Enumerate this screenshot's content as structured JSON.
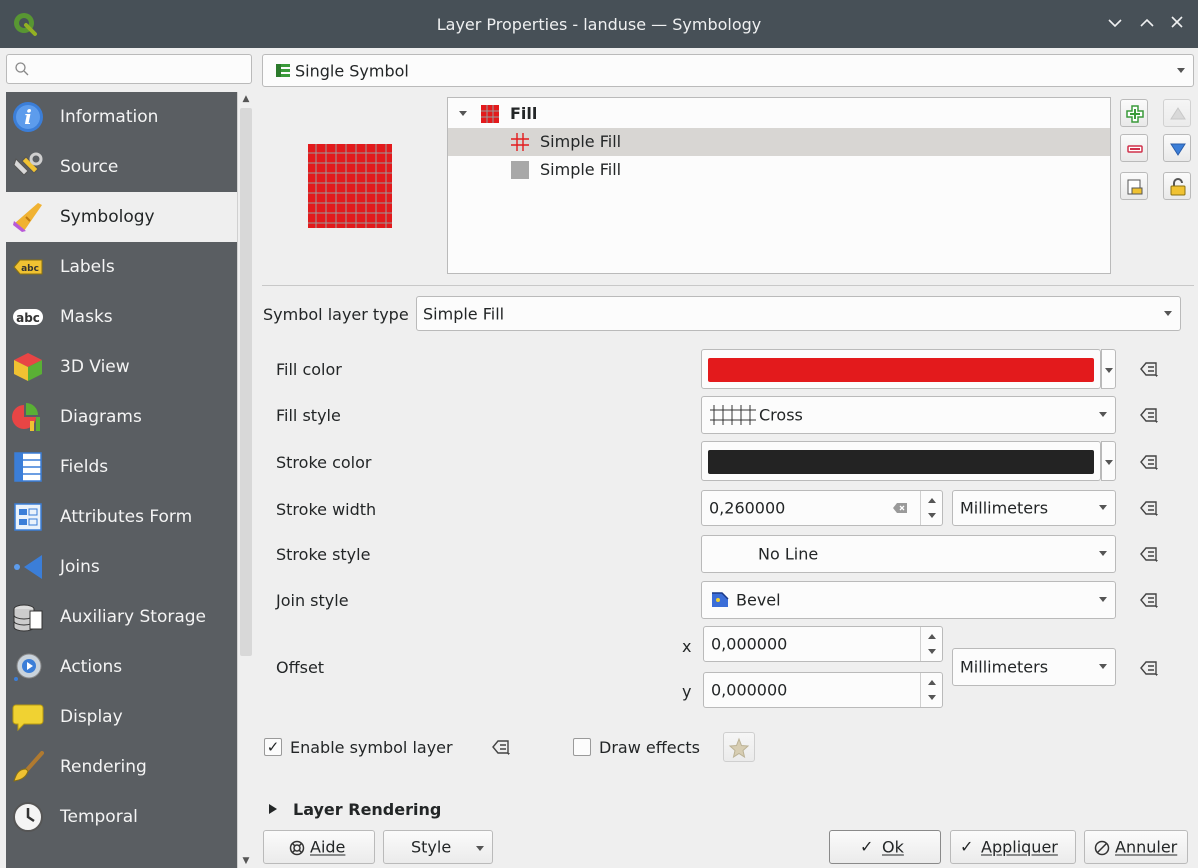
{
  "window": {
    "title": "Layer Properties - landuse — Symbology",
    "controls": [
      "chevron-down-icon",
      "chevron-up-icon",
      "close-icon"
    ]
  },
  "sidebar": {
    "search_placeholder": "",
    "items": [
      {
        "label": "Information",
        "icon": "info-icon"
      },
      {
        "label": "Source",
        "icon": "source-icon"
      },
      {
        "label": "Symbology",
        "icon": "paintbrush-icon",
        "active": true
      },
      {
        "label": "Labels",
        "icon": "labels-icon"
      },
      {
        "label": "Masks",
        "icon": "masks-icon"
      },
      {
        "label": "3D View",
        "icon": "cube-icon"
      },
      {
        "label": "Diagrams",
        "icon": "diagrams-icon"
      },
      {
        "label": "Fields",
        "icon": "fields-icon"
      },
      {
        "label": "Attributes Form",
        "icon": "form-icon"
      },
      {
        "label": "Joins",
        "icon": "joins-icon"
      },
      {
        "label": "Auxiliary Storage",
        "icon": "database-icon"
      },
      {
        "label": "Actions",
        "icon": "actions-icon"
      },
      {
        "label": "Display",
        "icon": "speech-bubble-icon"
      },
      {
        "label": "Rendering",
        "icon": "brush-icon"
      },
      {
        "label": "Temporal",
        "icon": "clock-icon"
      }
    ]
  },
  "renderer": {
    "value": "Single Symbol",
    "icon": "single-symbol-icon"
  },
  "symbol_tree": {
    "root": {
      "label": "Fill",
      "expanded": true
    },
    "layers": [
      {
        "label": "Simple Fill",
        "selected": true,
        "icon": "cross-fill-icon"
      },
      {
        "label": "Simple Fill",
        "selected": false,
        "icon": "gray-fill-icon"
      }
    ]
  },
  "symbol_layer_type": {
    "label": "Symbol layer type",
    "value": "Simple Fill"
  },
  "properties": {
    "fill_color": {
      "label": "Fill color",
      "color": "#e31a1c"
    },
    "fill_style": {
      "label": "Fill style",
      "value": "Cross"
    },
    "stroke_color": {
      "label": "Stroke color",
      "color": "#232323"
    },
    "stroke_width": {
      "label": "Stroke width",
      "value": "0,260000",
      "unit": "Millimeters"
    },
    "stroke_style": {
      "label": "Stroke style",
      "value": "No Line"
    },
    "join_style": {
      "label": "Join style",
      "value": "Bevel"
    },
    "offset": {
      "label": "Offset",
      "x_label": "x",
      "x_value": "0,000000",
      "y_label": "y",
      "y_value": "0,000000",
      "unit": "Millimeters"
    }
  },
  "options": {
    "enable_symbol_layer": {
      "label": "Enable symbol layer",
      "checked": true
    },
    "draw_effects": {
      "label": "Draw effects",
      "checked": false
    }
  },
  "layer_rendering": {
    "label": "Layer Rendering",
    "expanded": false
  },
  "buttons": {
    "help": "Aide",
    "style": "Style",
    "ok": "Ok",
    "apply": "Appliquer",
    "cancel": "Annuler"
  },
  "colors": {
    "titlebar": "#475057",
    "sidebar_bg": "#5a5e62",
    "accent": "#3daee9"
  }
}
